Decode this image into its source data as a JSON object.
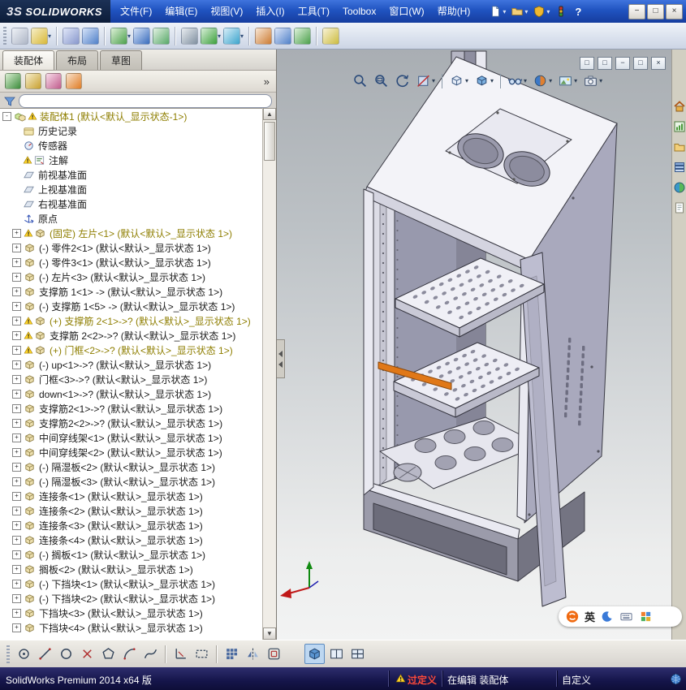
{
  "titlebar": {
    "logo_mark": "3S",
    "logo_text": "SOLIDWORKS",
    "menus": [
      "文件(F)",
      "编辑(E)",
      "视图(V)",
      "插入(I)",
      "工具(T)",
      "Toolbox",
      "窗口(W)",
      "帮助(H)"
    ],
    "help_label": "?",
    "quick_icons": [
      {
        "name": "new-document-icon",
        "glyph": "page",
        "dropdown": true
      },
      {
        "name": "open-document-icon",
        "glyph": "openfolder",
        "dropdown": true
      },
      {
        "name": "solidworks-help-icon",
        "glyph": "shield",
        "dropdown": true
      },
      {
        "name": "rx-diagnostics-icon",
        "glyph": "traffic"
      }
    ],
    "window_buttons": [
      {
        "name": "minimize-button",
        "glyph": "−"
      },
      {
        "name": "maximize-button",
        "glyph": "□"
      },
      {
        "name": "close-button",
        "glyph": "×"
      }
    ]
  },
  "toolbar": {
    "items": [
      {
        "name": "edit-component-icon",
        "c1": "#aeb6c6",
        "c2": "#eef1f6"
      },
      {
        "name": "external-references-icon",
        "c1": "#d8b838",
        "c2": "#f6eec6",
        "dropdown": true
      },
      {
        "sep": true
      },
      {
        "name": "mate-icon",
        "c1": "#8898cc",
        "c2": "#e0e6f8"
      },
      {
        "name": "linear-component-pattern-icon",
        "c1": "#5080c8",
        "c2": "#d4e2f8"
      },
      {
        "sep": true
      },
      {
        "name": "insert-components-icon",
        "c1": "#4ca04c",
        "c2": "#dcf0d6",
        "dropdown": true
      },
      {
        "name": "smart-fasteners-icon",
        "c1": "#3a6cbc",
        "c2": "#d4e2f8"
      },
      {
        "name": "move-component-icon",
        "c1": "#58a868",
        "c2": "#e2f2e2"
      },
      {
        "sep": true
      },
      {
        "name": "show-hidden-components-icon",
        "c1": "#8090a0",
        "c2": "#e8ecf0"
      },
      {
        "name": "assembly-features-icon",
        "c1": "#3ca03c",
        "c2": "#d6eed6",
        "dropdown": true
      },
      {
        "name": "reference-geometry-icon",
        "c1": "#3ca4cc",
        "c2": "#d6eef8",
        "dropdown": true
      },
      {
        "sep": true
      },
      {
        "name": "new-motion-study-icon",
        "c1": "#cc7c34",
        "c2": "#f8e6d4"
      },
      {
        "name": "bill-of-materials-icon",
        "c1": "#5080c8",
        "c2": "#dce6f8"
      },
      {
        "name": "exploded-view-icon",
        "c1": "#4ca04c",
        "c2": "#def2da"
      },
      {
        "sep": true
      },
      {
        "name": "instant3d-icon",
        "c1": "#ccbc40",
        "c2": "#f8f2d6"
      }
    ]
  },
  "panel": {
    "tabs": [
      {
        "label": "装配体",
        "active": true
      },
      {
        "label": "布局",
        "active": false
      },
      {
        "label": "草图",
        "active": false
      }
    ],
    "overflow_label": "»",
    "header_icons": [
      {
        "name": "featuremanager-design-tree-icon",
        "c1": "#3c8c3c",
        "c2": "#d8eed0"
      },
      {
        "name": "propertymanager-icon",
        "c1": "#c8a030",
        "c2": "#f6eecb"
      },
      {
        "name": "configurationmanager-icon",
        "c1": "#c05c8c",
        "c2": "#f8dcea"
      },
      {
        "name": "displaymanager-icon",
        "c1": "#e07c24",
        "c2": "#f8e2cc"
      }
    ],
    "filter_placeholder": "",
    "tree": [
      {
        "label": "装配体1 (默认<默认_显示状态-1>)",
        "icon": "assembly",
        "warn": true,
        "olive": true,
        "expander": "-"
      },
      {
        "label": "历史记录",
        "icon": "history"
      },
      {
        "label": "传感器",
        "icon": "sensor"
      },
      {
        "label": "注解",
        "icon": "annotations",
        "warn": true
      },
      {
        "label": "前视基准面",
        "icon": "plane"
      },
      {
        "label": "上视基准面",
        "icon": "plane"
      },
      {
        "label": "右视基准面",
        "icon": "plane"
      },
      {
        "label": "原点",
        "icon": "origin"
      },
      {
        "label": "(固定) 左片<1> (默认<默认>_显示状态 1>)",
        "icon": "part",
        "warn": true,
        "olive": true,
        "expander": "+"
      },
      {
        "label": "(-) 零件2<1> (默认<默认>_显示状态 1>)",
        "icon": "part",
        "expander": "+"
      },
      {
        "label": "(-) 零件3<1> (默认<默认>_显示状态 1>)",
        "icon": "part",
        "expander": "+"
      },
      {
        "label": "(-) 左片<3> (默认<默认>_显示状态 1>)",
        "icon": "part",
        "expander": "+"
      },
      {
        "label": "支撑筋 1<1> -> (默认<默认>_显示状态 1>)",
        "icon": "part",
        "expander": "+"
      },
      {
        "label": "(-) 支撑筋 1<5> -> (默认<默认>_显示状态 1>)",
        "icon": "part",
        "expander": "+"
      },
      {
        "label": "(+) 支撑筋 2<1>->? (默认<默认>_显示状态 1>)",
        "icon": "part",
        "warn": true,
        "olive": true,
        "expander": "+"
      },
      {
        "label": "支撑筋 2<2>->? (默认<默认>_显示状态 1>)",
        "icon": "part",
        "warn": true,
        "expander": "+"
      },
      {
        "label": "(+) 门框<2>->? (默认<默认>_显示状态 1>)",
        "icon": "part",
        "warn": true,
        "olive": true,
        "expander": "+"
      },
      {
        "label": "(-) up<1>->? (默认<默认>_显示状态 1>)",
        "icon": "part",
        "expander": "+"
      },
      {
        "label": "门框<3>->? (默认<默认>_显示状态 1>)",
        "icon": "part",
        "expander": "+"
      },
      {
        "label": "down<1>->? (默认<默认>_显示状态 1>)",
        "icon": "part",
        "expander": "+"
      },
      {
        "label": "支撑筋2<1>->? (默认<默认>_显示状态 1>)",
        "icon": "part",
        "expander": "+"
      },
      {
        "label": "支撑筋2<2>->? (默认<默认>_显示状态 1>)",
        "icon": "part",
        "expander": "+"
      },
      {
        "label": "中间穿线架<1> (默认<默认>_显示状态 1>)",
        "icon": "part",
        "expander": "+"
      },
      {
        "label": "中间穿线架<2> (默认<默认>_显示状态 1>)",
        "icon": "part",
        "expander": "+"
      },
      {
        "label": "(-) 隔湿板<2> (默认<默认>_显示状态 1>)",
        "icon": "part",
        "expander": "+"
      },
      {
        "label": "(-) 隔湿板<3> (默认<默认>_显示状态 1>)",
        "icon": "part",
        "expander": "+"
      },
      {
        "label": "连接条<1> (默认<默认>_显示状态 1>)",
        "icon": "part",
        "expander": "+"
      },
      {
        "label": "连接条<2> (默认<默认>_显示状态 1>)",
        "icon": "part",
        "expander": "+"
      },
      {
        "label": "连接条<3> (默认<默认>_显示状态 1>)",
        "icon": "part",
        "expander": "+"
      },
      {
        "label": "连接条<4> (默认<默认>_显示状态 1>)",
        "icon": "part",
        "expander": "+"
      },
      {
        "label": "(-) 搁板<1> (默认<默认>_显示状态 1>)",
        "icon": "part",
        "expander": "+"
      },
      {
        "label": "搁板<2> (默认<默认>_显示状态 1>)",
        "icon": "part",
        "expander": "+"
      },
      {
        "label": "(-) 下挡块<1> (默认<默认>_显示状态 1>)",
        "icon": "part",
        "expander": "+"
      },
      {
        "label": "(-) 下挡块<2> (默认<默认>_显示状态 1>)",
        "icon": "part",
        "expander": "+"
      },
      {
        "label": "下挡块<3> (默认<默认>_显示状态 1>)",
        "icon": "part",
        "expander": "+"
      },
      {
        "label": "下挡块<4> (默认<默认>_显示状态 1>)",
        "icon": "part",
        "expander": "+"
      }
    ]
  },
  "viewport": {
    "hud": [
      {
        "name": "zoom-to-fit-icon",
        "glyph": "magnifier"
      },
      {
        "name": "zoom-to-area-icon",
        "glyph": "magnifier-area"
      },
      {
        "name": "previous-view-icon",
        "glyph": "rotate"
      },
      {
        "name": "section-view-icon",
        "glyph": "section",
        "dropdown": true
      },
      {
        "sep": true
      },
      {
        "name": "view-orientation-icon",
        "glyph": "cube",
        "dropdown": true
      },
      {
        "name": "display-style-icon",
        "glyph": "cube-shaded",
        "dropdown": true
      },
      {
        "sep": true
      },
      {
        "name": "hide-show-items-icon",
        "glyph": "glasses",
        "dropdown": true
      },
      {
        "name": "edit-appearance-icon",
        "glyph": "ball",
        "dropdown": true
      },
      {
        "name": "apply-scene-icon",
        "glyph": "scene",
        "dropdown": true
      },
      {
        "name": "view-settings-icon",
        "glyph": "camera",
        "dropdown": true
      }
    ],
    "doc_buttons": [
      {
        "name": "previous-window-icon",
        "glyph": "□"
      },
      {
        "name": "next-window-icon",
        "glyph": "□"
      },
      {
        "name": "minimize-window-icon",
        "glyph": "−"
      },
      {
        "name": "restore-window-icon",
        "glyph": "□"
      },
      {
        "name": "close-window-icon",
        "glyph": "×"
      }
    ]
  },
  "taskpane": {
    "icons": [
      {
        "name": "solidworks-resources-icon",
        "glyph": "home"
      },
      {
        "name": "design-library-icon",
        "glyph": "chart"
      },
      {
        "name": "file-explorer-icon",
        "glyph": "folder2"
      },
      {
        "name": "view-palette-icon",
        "glyph": "stack"
      },
      {
        "name": "appearances-icon",
        "glyph": "sphere"
      },
      {
        "name": "custom-properties-icon",
        "glyph": "sheet"
      }
    ]
  },
  "bottombar": {
    "items": [
      {
        "name": "sketch-point-icon",
        "glyph": "dot-circle"
      },
      {
        "name": "line-icon",
        "glyph": "line"
      },
      {
        "name": "circle-icon",
        "glyph": "circle"
      },
      {
        "name": "trim-entities-icon",
        "glyph": "cross"
      },
      {
        "name": "polygon-icon",
        "glyph": "polygon"
      },
      {
        "name": "arc-icon",
        "glyph": "arc"
      },
      {
        "name": "spline-icon",
        "glyph": "spline"
      },
      {
        "sep": true
      },
      {
        "name": "smart-dimension-icon",
        "glyph": "dim"
      },
      {
        "name": "construction-geometry-icon",
        "glyph": "dashed-rect"
      },
      {
        "sep": true
      },
      {
        "name": "linear-pattern-icon",
        "glyph": "grid"
      },
      {
        "name": "mirror-entities-icon",
        "glyph": "mirror"
      },
      {
        "name": "offset-entities-icon",
        "glyph": "offset"
      },
      {
        "gap": true
      },
      {
        "name": "single-viewport-icon",
        "glyph": "pane-shaded",
        "active": true
      },
      {
        "name": "two-viewport-icon",
        "glyph": "pane-split"
      },
      {
        "name": "four-viewport-icon",
        "glyph": "pane-quad"
      }
    ]
  },
  "ime": {
    "lang": "英",
    "icons": [
      {
        "name": "sogou-logo-icon",
        "glyph": "sogou"
      },
      {
        "name": "night-mode-icon",
        "glyph": "moon"
      },
      {
        "name": "soft-keyboard-icon",
        "glyph": "keyboard"
      },
      {
        "name": "ime-toolbox-icon",
        "glyph": "imegrid"
      }
    ]
  },
  "statusbar": {
    "product": "SolidWorks Premium 2014 x64 版",
    "overdefined_label": "过定义",
    "editing_label": "在编辑 装配体",
    "custom_label": "自定义"
  },
  "colors": {
    "titlebar_blue": "#2053c0",
    "warning_yellow": "#ffd428",
    "overdefined_red": "#ff4a3a",
    "cabinet_body": "#f3f3f8",
    "cabinet_side": "#a9a9bd",
    "orange_bracket": "#e07818"
  }
}
